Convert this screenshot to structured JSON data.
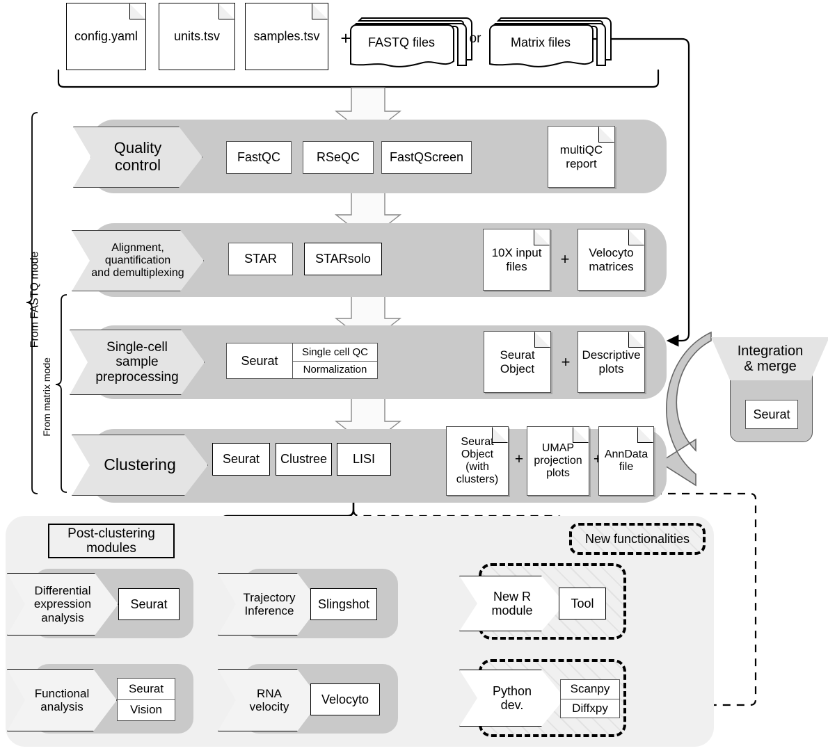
{
  "inputs": {
    "files": [
      {
        "label": "config.yaml"
      },
      {
        "label": "units.tsv"
      },
      {
        "label": "samples.tsv"
      }
    ],
    "plus": "+",
    "or": "or",
    "fastq_files": "FASTQ files",
    "matrix_files": "Matrix files"
  },
  "modes": {
    "fastq": "From FASTQ mode",
    "matrix": "From matrix mode"
  },
  "bands": [
    {
      "name": "quality-control",
      "title": "Quality\ncontrol",
      "tools": [
        "FastQC",
        "RSeQC",
        "FastQScreen"
      ],
      "outputs": [
        "multiQC\nreport"
      ]
    },
    {
      "name": "alignment",
      "title": "Alignment,\nquantification\nand demultiplexing",
      "tools": [
        "STAR",
        "STARsolo"
      ],
      "outputs": [
        "10X input\nfiles",
        "Velocyto\nmatrices"
      ]
    },
    {
      "name": "preprocessing",
      "title": "Single-cell\nsample\npreprocessing",
      "tools": [
        "Seurat"
      ],
      "subtools": [
        "Single cell QC",
        "Normalization"
      ],
      "outputs": [
        "Seurat\nObject",
        "Descriptive\nplots"
      ]
    },
    {
      "name": "clustering",
      "title": "Clustering",
      "tools": [
        "Seurat",
        "Clustree",
        "LISI"
      ],
      "outputs": [
        "Seurat\nObject\n(with\nclusters)",
        "UMAP\nprojection\nplots",
        "AnnData\nfile"
      ]
    }
  ],
  "integration": {
    "title": "Integration\n& merge",
    "tool": "Seurat"
  },
  "post_clustering": {
    "heading": "Post-clustering\nmodules",
    "modules": [
      {
        "name": "differential-expression",
        "title": "Differential\nexpression\nanalysis",
        "tools": [
          "Seurat"
        ]
      },
      {
        "name": "trajectory-inference",
        "title": "Trajectory\nInference",
        "tools": [
          "Slingshot"
        ]
      },
      {
        "name": "functional-analysis",
        "title": "Functional\nanalysis",
        "tools": [
          "Seurat",
          "Vision"
        ]
      },
      {
        "name": "rna-velocity",
        "title": "RNA\nvelocity",
        "tools": [
          "Velocyto"
        ]
      }
    ]
  },
  "new_functionalities": {
    "badge": "New functionalities",
    "modules": [
      {
        "name": "new-r-module",
        "title": "New R\nmodule",
        "tools": [
          "Tool"
        ]
      },
      {
        "name": "python-dev",
        "title": "Python\ndev.",
        "tools": [
          "Scanpy",
          "Diffxpy"
        ]
      }
    ]
  },
  "symbols": {
    "plus": "+"
  },
  "colors": {
    "band": "#c9c9c9",
    "chevron": "#e4e4e4",
    "panel": "#f0f0f0",
    "ink": "#000000"
  }
}
